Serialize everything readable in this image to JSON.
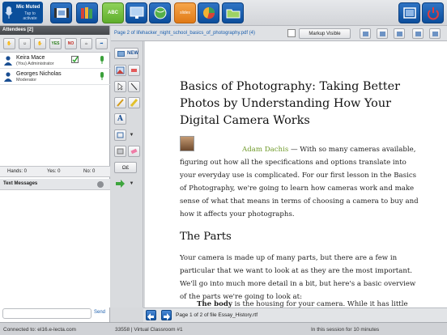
{
  "toolbar": {
    "mic_label": "Mic Muted",
    "mic_hint": "Tap to activate",
    "buttons": [
      "whiteboard",
      "webcam",
      "books",
      "share-app",
      "desktop-share",
      "web-tour",
      "slides",
      "chart",
      "folder",
      "layout",
      "power"
    ],
    "abc_label": "ABC",
    "slides_label": "slides"
  },
  "attendees": {
    "header": "Attendees [2]",
    "buttons": {
      "yes": "YES",
      "no": "NO"
    },
    "users": [
      {
        "name": "Keira Mace",
        "role": "(You) Administrator"
      },
      {
        "name": "Georges Nicholas",
        "role": "Moderator"
      }
    ],
    "counts": {
      "hands": "Hands: 0",
      "yes": "Yes: 0",
      "no": "No: 0"
    }
  },
  "messages": {
    "header": "Text Messages",
    "send_label": "Send"
  },
  "tools": {
    "new_label": "NEW",
    "text_tool": "A",
    "omega": "Ω£"
  },
  "document": {
    "tab_title": "Page 2 of lifehacker_night_school_basics_of_photography.pdf (4)",
    "markup_label": "Markup Visible",
    "title": "Basics of Photography: Taking Better Photos by Understanding How Your Digital Camera Works",
    "author": "Adam Dachis",
    "intro": "— With so many cameras available, figuring out how all the specifications and options translate into your everyday use is complicated. For our first lesson in the Basics of Photography, we're going to learn how cameras work and make sense of what that means in terms of choosing a camera to buy and how it affects your photographs.",
    "section_heading": "The Parts",
    "section_text": "Your camera is made up of many parts, but there are a few in particular that we want to look at as they are the most important. We'll go into much more detail in a bit, but here's a basic overview of the parts we're going to look at:",
    "bullet_bold": "The body",
    "bullet_text": " is the housing for your camera. While it has little"
  },
  "pagenav": {
    "info": "Page 1 of 2 of file Essay_History.rtf"
  },
  "status": {
    "connection": "Connected to: el16.e-lecta.com",
    "classroom": "33558 | Virtual Classroom #1",
    "session": "In this session for 10 minutes"
  }
}
